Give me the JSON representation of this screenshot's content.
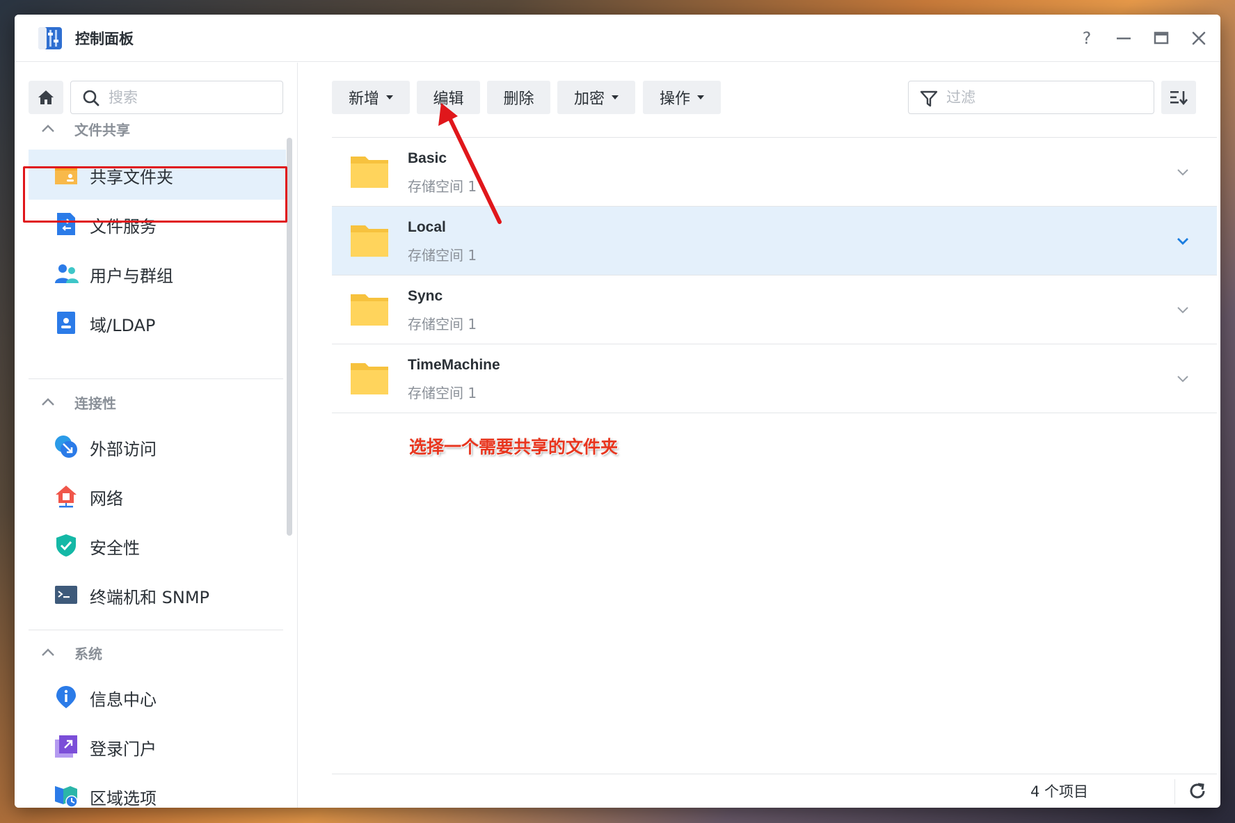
{
  "window": {
    "title": "控制面板",
    "controls": {
      "help": "?",
      "minimize": "—",
      "maximize": "▭",
      "close": "✕"
    }
  },
  "sidebar": {
    "search_placeholder": "搜索",
    "sections": [
      {
        "header": "文件共享",
        "items": [
          {
            "label": "共享文件夹",
            "icon": "shared-folder-icon"
          },
          {
            "label": "文件服务",
            "icon": "file-services-icon"
          },
          {
            "label": "用户与群组",
            "icon": "users-groups-icon"
          },
          {
            "label": "域/LDAP",
            "icon": "domain-ldap-icon"
          }
        ]
      },
      {
        "header": "连接性",
        "items": [
          {
            "label": "外部访问",
            "icon": "external-access-icon"
          },
          {
            "label": "网络",
            "icon": "network-icon"
          },
          {
            "label": "安全性",
            "icon": "security-icon"
          },
          {
            "label": "终端机和 SNMP",
            "icon": "terminal-snmp-icon"
          }
        ]
      },
      {
        "header": "系统",
        "items": [
          {
            "label": "信息中心",
            "icon": "info-center-icon"
          },
          {
            "label": "登录门户",
            "icon": "login-portal-icon"
          },
          {
            "label": "区域选项",
            "icon": "regional-options-icon"
          }
        ]
      }
    ]
  },
  "toolbar": {
    "create": "新增",
    "edit": "编辑",
    "delete": "删除",
    "encrypt": "加密",
    "action": "操作",
    "filter_placeholder": "过滤"
  },
  "folders": [
    {
      "name": "Basic",
      "location": "存储空间 1",
      "selected": false
    },
    {
      "name": "Local",
      "location": "存储空间 1",
      "selected": true
    },
    {
      "name": "Sync",
      "location": "存储空间 1",
      "selected": false
    },
    {
      "name": "TimeMachine",
      "location": "存储空间 1",
      "selected": false
    }
  ],
  "annotation": "选择一个需要共享的文件夹",
  "footer": {
    "count": "4 个项目"
  },
  "colors": {
    "accent": "#1a7de0",
    "selected_row": "#e4f0fb",
    "folder": "#ffd45c",
    "annotation": "#e8361f",
    "highlight_box": "#e0171b"
  }
}
